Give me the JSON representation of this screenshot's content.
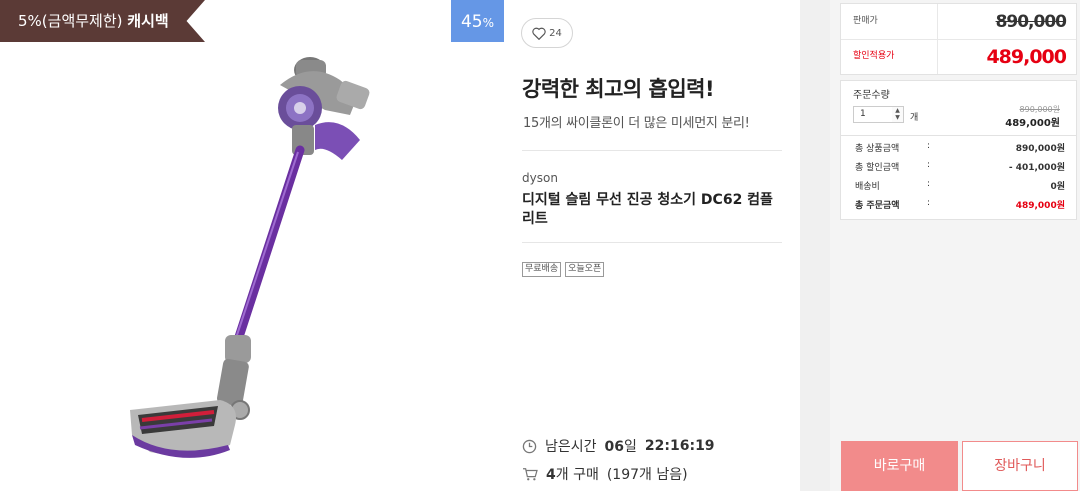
{
  "badges": {
    "cashback_prefix": "5%(금액무제한)",
    "cashback_strong": "캐시백",
    "discount_value": "45",
    "discount_unit": "%"
  },
  "like": {
    "count": "24",
    "icon": "heart-icon"
  },
  "headline": "강력한 최고의 흡입력!",
  "subline": "15개의 싸이클론이 더 많은 미세먼지 분리!",
  "brand": "dyson",
  "product_name": "디지털 슬림 무선 진공 청소기 DC62 컴플리트",
  "tags": [
    "무료배송",
    "오늘오픈"
  ],
  "timer": {
    "label": "남은시간",
    "days": "06",
    "day_unit": "일",
    "time": "22:16:19",
    "icon": "clock-icon"
  },
  "sold": {
    "count": "4",
    "unit": "개 구매",
    "remaining": "(197개 남음)",
    "icon": "cart-icon"
  },
  "price": {
    "original_label": "판매가",
    "original_value": "890,000",
    "sale_label": "할인적용가",
    "sale_value": "489,000"
  },
  "order": {
    "qty_title": "주문수량",
    "qty_value": "1",
    "qty_unit": "개",
    "line_original": "890,000원",
    "line_sale": "489,000원"
  },
  "summary": [
    {
      "key": "총 상품금액",
      "sep": ":",
      "value": "890,000원"
    },
    {
      "key": "총 할인금액",
      "sep": ":",
      "value": "- 401,000원"
    },
    {
      "key": "배송비",
      "sep": ":",
      "value": "0원"
    },
    {
      "key": "총 주문금액",
      "sep": ":",
      "value": "489,000원"
    }
  ],
  "actions": {
    "buy_label": "바로구매",
    "cart_label": "장바구니"
  },
  "colors": {
    "banner": "#5b3a36",
    "discount_badge": "#6597e6",
    "sale_red": "#e60012",
    "buy_button": "#f28b8b"
  }
}
